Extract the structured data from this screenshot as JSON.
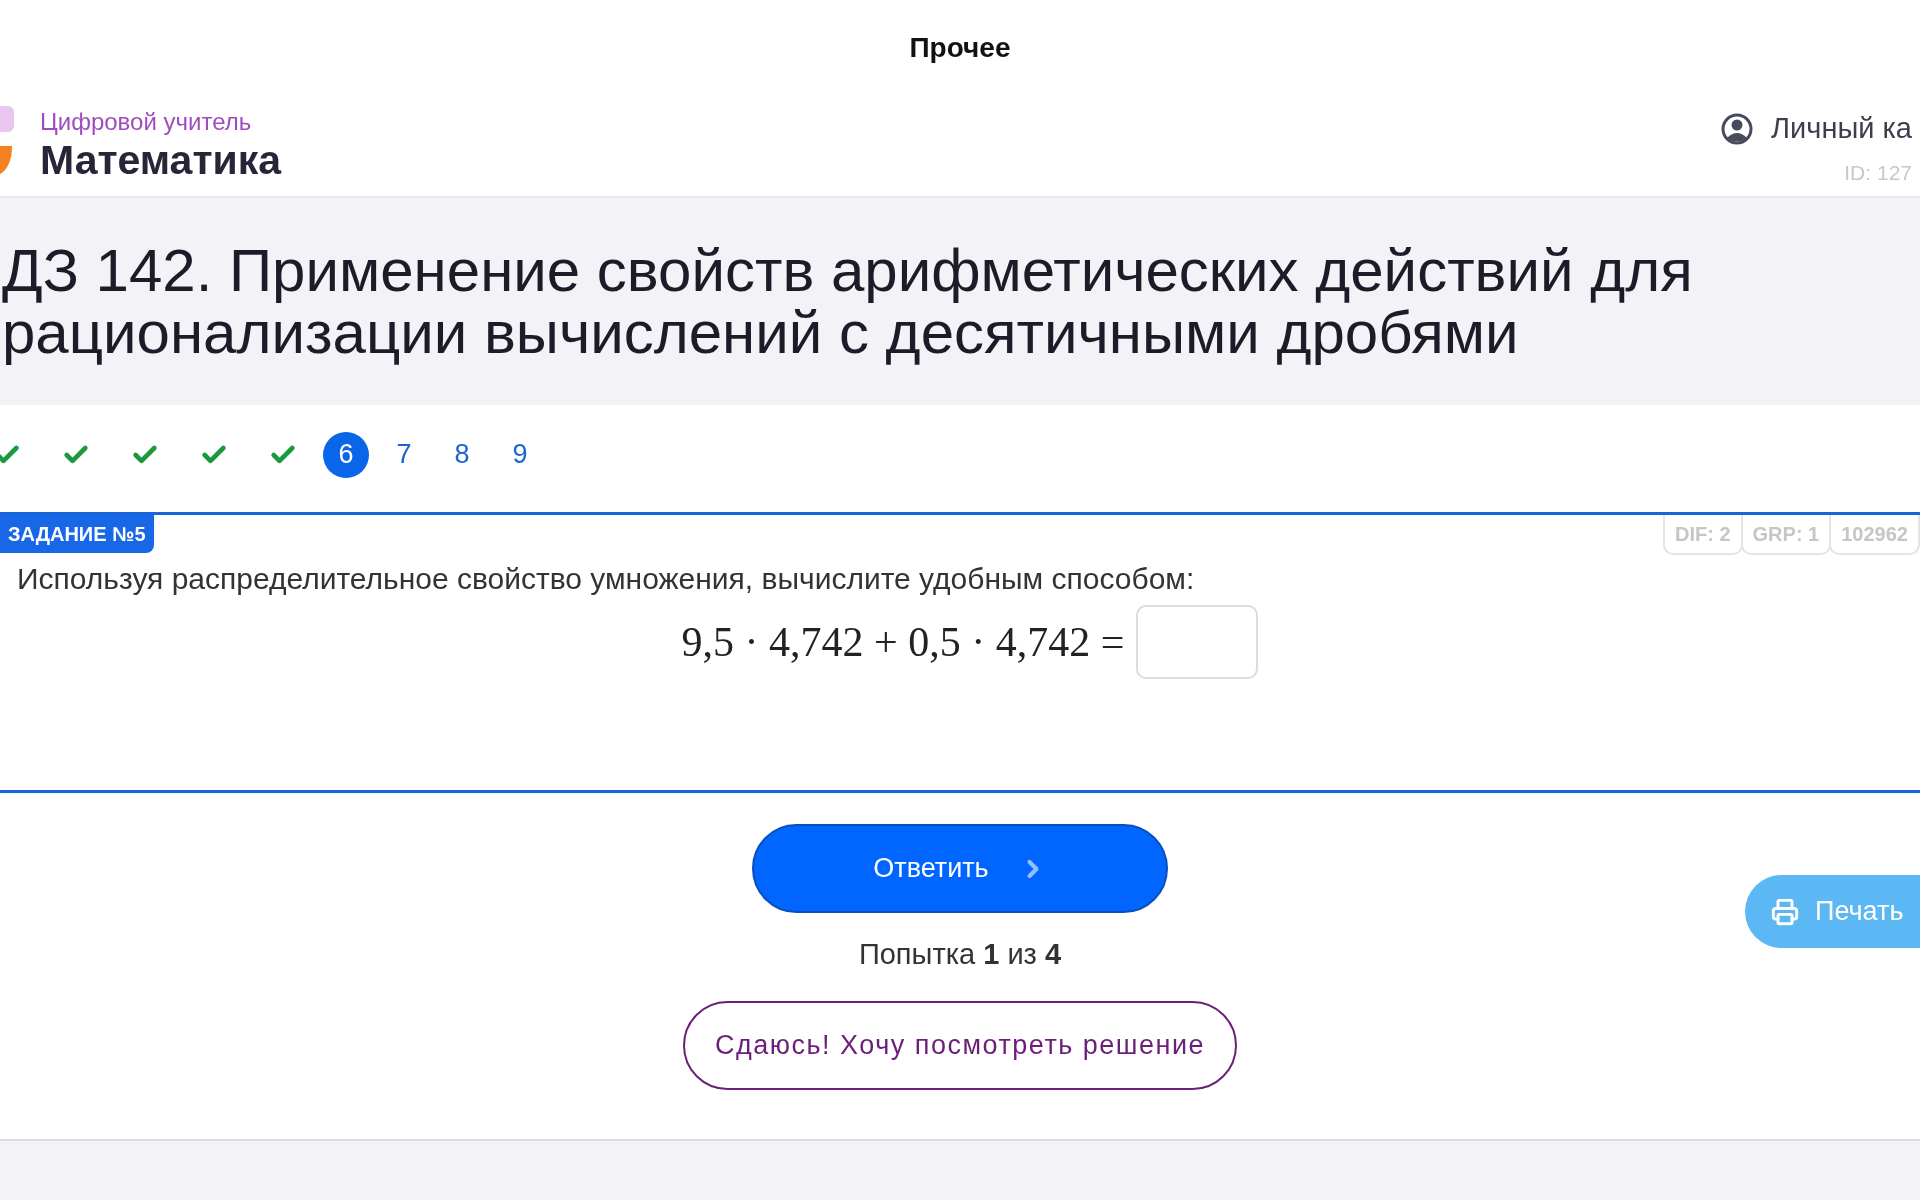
{
  "top_bar": {
    "title": "Прочее"
  },
  "header": {
    "brand": "Цифровой учитель",
    "subject": "Математика",
    "account_link": "Личный ка",
    "user_id": "ID: 127"
  },
  "lesson": {
    "title": "ДЗ 142. Применение свойств арифметических действий для рационализации вычислений с десятичными дробями"
  },
  "steps": [
    {
      "kind": "done",
      "selected": false
    },
    {
      "kind": "done",
      "selected": false
    },
    {
      "kind": "done",
      "selected": false
    },
    {
      "kind": "done",
      "selected": false
    },
    {
      "kind": "done",
      "selected": false
    },
    {
      "kind": "number",
      "label": "6",
      "selected": true
    },
    {
      "kind": "number",
      "label": "7",
      "selected": false
    },
    {
      "kind": "number",
      "label": "8",
      "selected": false
    },
    {
      "kind": "number",
      "label": "9",
      "selected": false
    }
  ],
  "task": {
    "badge": "ЗАДАНИЕ №5",
    "tags": [
      "DIF: 2",
      "GRP: 1",
      "102962"
    ],
    "question": "Используя распределительное свойство умножения, вычислите удобным способом:",
    "expression": "9,5 · 4,742 + 0,5 · 4,742 ="
  },
  "submit_button": "Ответить",
  "attempt": "Попытка **1** из **4**",
  "give_up_button": "Сдаюсь! Хочу посмотреть решение",
  "print_button": "Печать"
}
